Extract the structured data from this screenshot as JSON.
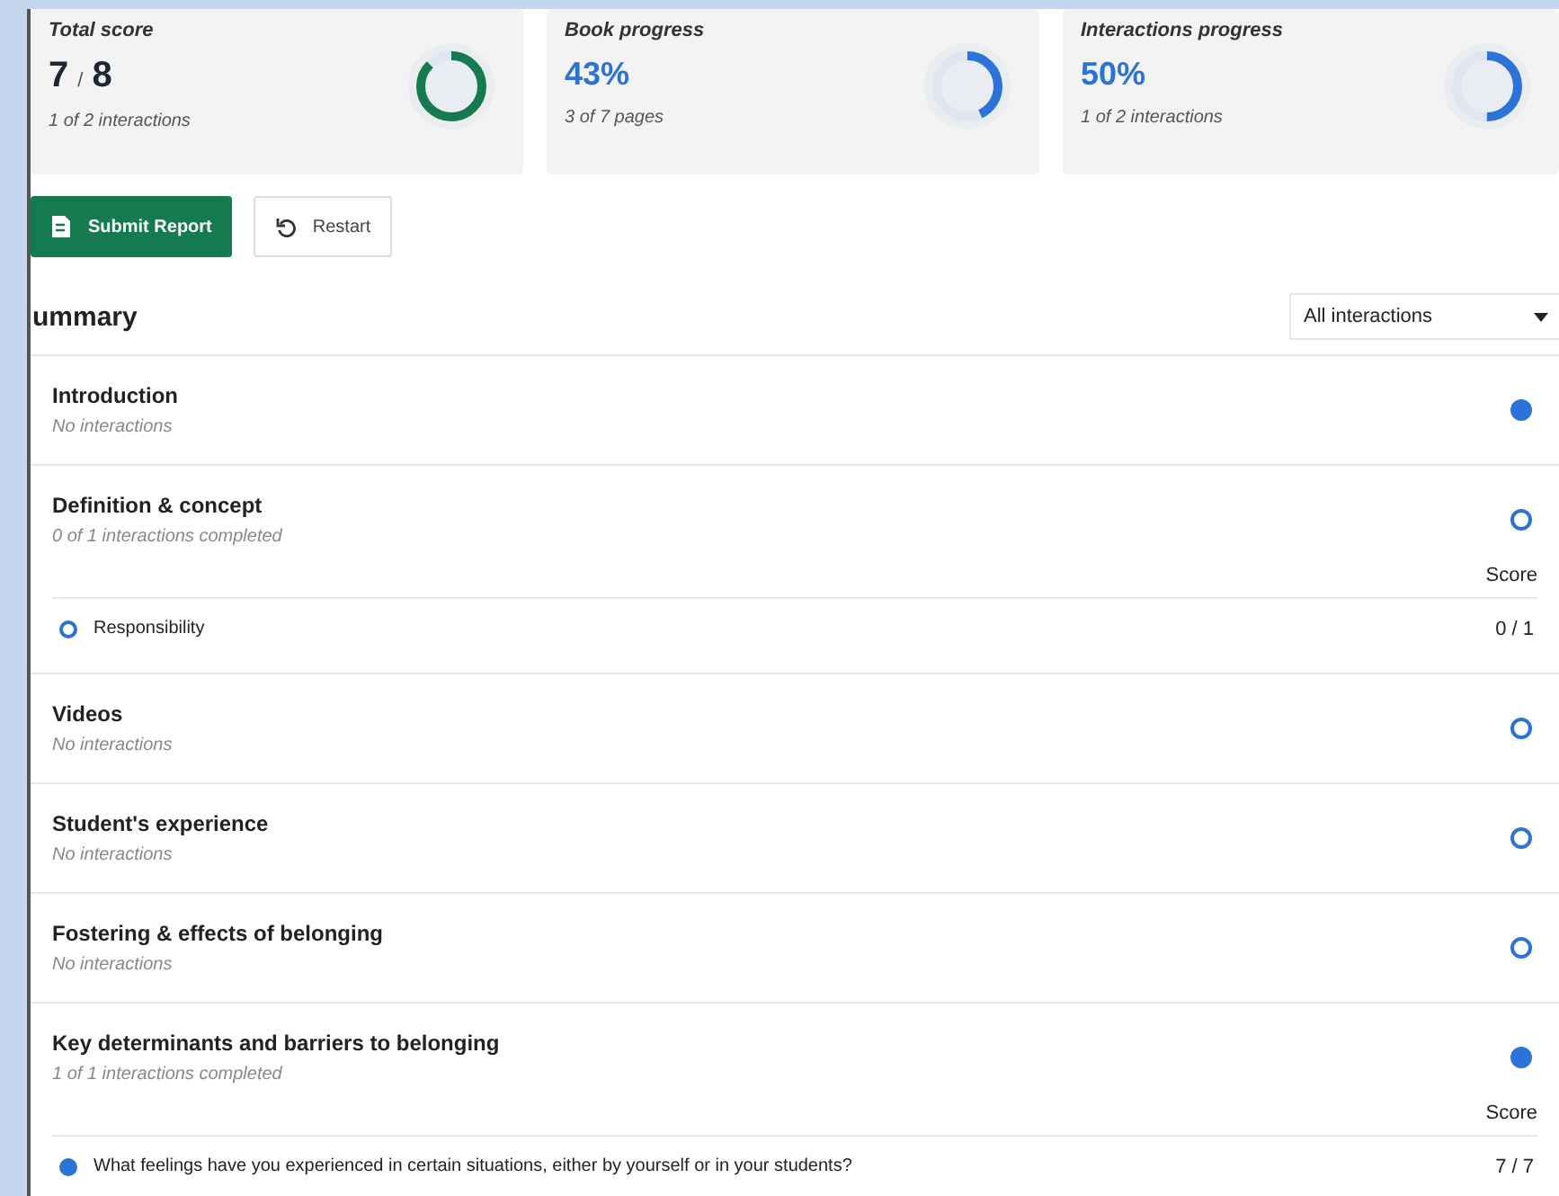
{
  "cards": [
    {
      "title": "Total score",
      "kind": "score",
      "value": "7",
      "total": "8",
      "separator": "/",
      "note": "1 of 2 interactions",
      "level": 0.875,
      "color": "#157a4f"
    },
    {
      "title": "Book progress",
      "kind": "percent",
      "value": "43%",
      "note": "3 of 7 pages",
      "level": 0.43,
      "color": "#2b73d6"
    },
    {
      "title": "Interactions progress",
      "kind": "percent",
      "value": "50%",
      "note": "1 of 2 interactions",
      "level": 0.5,
      "color": "#2b73d6"
    }
  ],
  "buttons": [
    {
      "label": "Submit Report",
      "kind": "primary"
    },
    {
      "label": "Restart",
      "kind": "secondary"
    }
  ],
  "summary": {
    "heading": "ummary",
    "filter": "All interactions"
  },
  "sections": [
    {
      "title": "Introduction",
      "subtitle": "No interactions",
      "completed": true
    },
    {
      "title": "Definition & concept",
      "subtitle": "0 of 1 interactions completed",
      "completed": false,
      "score_label": "Score",
      "interactions": [
        {
          "label": "Responsibility",
          "score": "0 / 1",
          "completed": false
        }
      ]
    },
    {
      "title": "Videos",
      "subtitle": "No interactions",
      "completed": false
    },
    {
      "title": "Student's experience",
      "subtitle": "No interactions",
      "completed": false
    },
    {
      "title": "Fostering & effects of belonging",
      "subtitle": "No interactions",
      "completed": false
    },
    {
      "title": "Key determinants and barriers to belonging",
      "subtitle": "1 of 1 interactions completed",
      "completed": true,
      "score_label": "Score",
      "interactions": [
        {
          "label": "What feelings have you experienced in certain situations, either by yourself or in your students?",
          "score": "7 / 7",
          "completed": true
        }
      ]
    }
  ]
}
